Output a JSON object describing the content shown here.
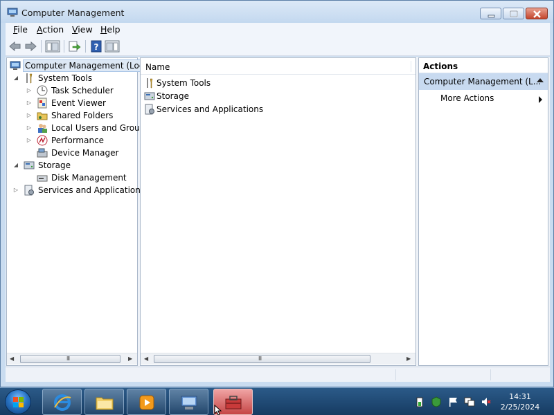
{
  "window": {
    "title": "Computer Management",
    "controls": {
      "minimize": "minimize",
      "maximize": "maximize",
      "close": "close"
    }
  },
  "menubar": {
    "items": [
      {
        "label_u": "F",
        "label_rest": "ile"
      },
      {
        "label_u": "A",
        "label_rest": "ction"
      },
      {
        "label_u": "V",
        "label_rest": "iew"
      },
      {
        "label_u": "H",
        "label_rest": "elp"
      }
    ]
  },
  "toolbar": {
    "icons": [
      "back-icon",
      "forward-icon",
      "show-hide-console-tree-icon",
      "export-list-icon",
      "help-icon",
      "show-hide-action-pane-icon"
    ]
  },
  "tree": {
    "root": "Computer Management (Local",
    "items": [
      {
        "label": "System Tools"
      },
      {
        "label": "Task Scheduler"
      },
      {
        "label": "Event Viewer"
      },
      {
        "label": "Shared Folders"
      },
      {
        "label": "Local Users and Groups"
      },
      {
        "label": "Performance"
      },
      {
        "label": "Device Manager"
      },
      {
        "label": "Storage"
      },
      {
        "label": "Disk Management"
      },
      {
        "label": "Services and Applications"
      }
    ]
  },
  "center": {
    "column_header": "Name",
    "rows": [
      {
        "label": "System Tools"
      },
      {
        "label": "Storage"
      },
      {
        "label": "Services and Applications"
      }
    ]
  },
  "actions": {
    "header": "Actions",
    "group": "Computer Management (L...",
    "more": "More Actions"
  },
  "scrollbar": {
    "grip": "III"
  },
  "taskbar": {
    "apps": [
      "internet-explorer",
      "windows-explorer",
      "media-player",
      "remote-desktop",
      "computer-management"
    ],
    "clock_time": "14:31",
    "clock_date": "2/25/2024"
  },
  "colors": {
    "selection": "#dde8f5",
    "actions_group": "#c8daf0",
    "taskbar": "#1f4f7a"
  }
}
